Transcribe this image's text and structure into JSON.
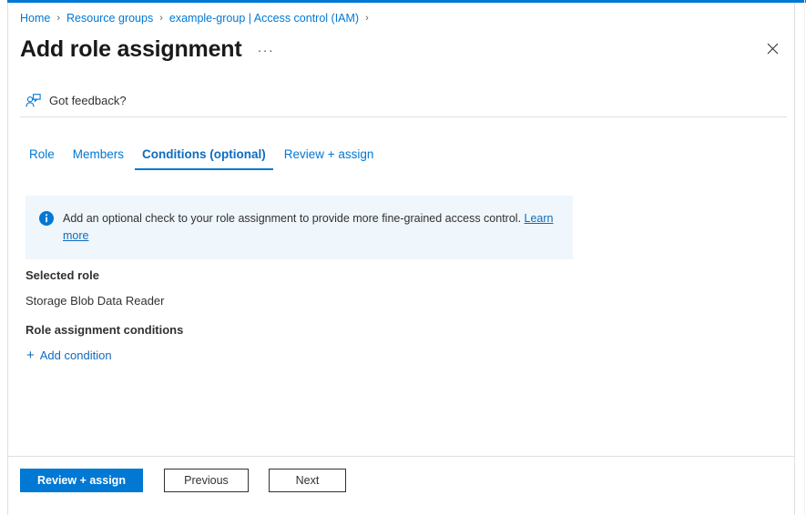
{
  "breadcrumb": {
    "separator": "›",
    "items": [
      {
        "label": "Home"
      },
      {
        "label": "Resource groups"
      },
      {
        "label": "example-group | Access control (IAM)"
      }
    ]
  },
  "header": {
    "title": "Add role assignment",
    "ellipsis": "···",
    "close_icon": "close-icon"
  },
  "feedback": {
    "icon": "feedback-person-icon",
    "label": "Got feedback?"
  },
  "tabs": [
    {
      "label": "Role",
      "active": false
    },
    {
      "label": "Members",
      "active": false
    },
    {
      "label": "Conditions (optional)",
      "active": true
    },
    {
      "label": "Review + assign",
      "active": false
    }
  ],
  "info_banner": {
    "icon": "info-icon",
    "text": "Add an optional check to your role assignment to provide more fine-grained access control. ",
    "link_text": "Learn more",
    "background": "#eff6fc"
  },
  "content": {
    "selected_role_heading": "Selected role",
    "selected_role_value": "Storage Blob Data Reader",
    "conditions_heading": "Role assignment conditions",
    "add_condition_plus": "+",
    "add_condition_label": "Add condition"
  },
  "footer": {
    "review_assign_label": "Review + assign",
    "previous_label": "Previous",
    "next_label": "Next"
  },
  "colors": {
    "accent": "#0078d4",
    "link": "#0f6cbd",
    "text": "#323130",
    "banner_bg": "#eff6fc",
    "border": "#e1dfdd"
  }
}
